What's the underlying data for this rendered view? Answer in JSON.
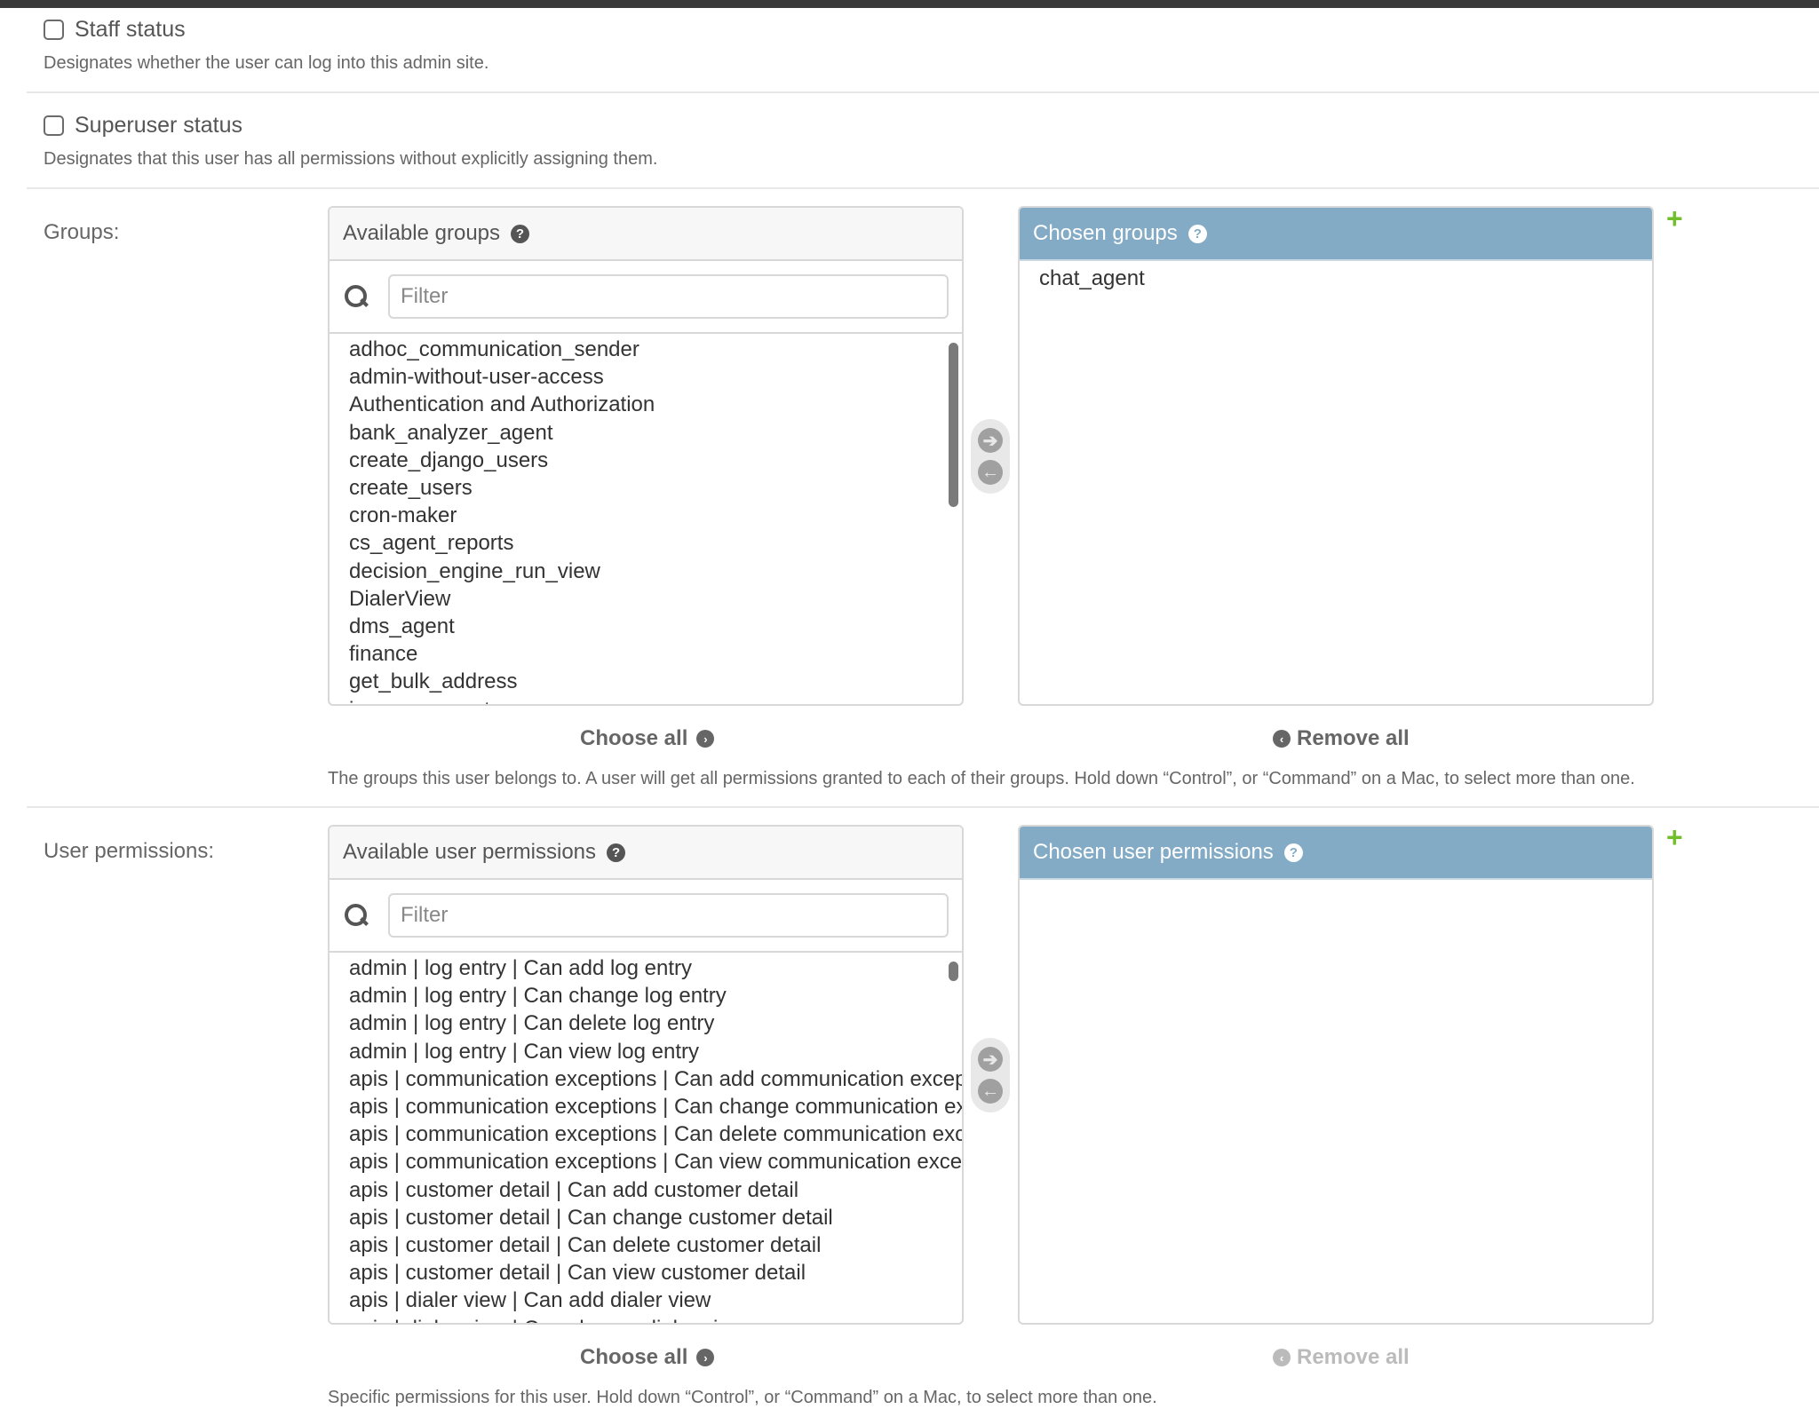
{
  "staff_status": {
    "label": "Staff status",
    "checked": false,
    "help": "Designates whether the user can log into this admin site."
  },
  "superuser_status": {
    "label": "Superuser status",
    "checked": false,
    "help": "Designates that this user has all permissions without explicitly assigning them."
  },
  "groups": {
    "label": "Groups:",
    "available_title": "Available groups",
    "chosen_title": "Chosen groups",
    "filter_placeholder": "Filter",
    "filter_value": "",
    "available": [
      "adhoc_communication_sender",
      "admin-without-user-access",
      "Authentication and Authorization",
      "bank_analyzer_agent",
      "create_django_users",
      "create_users",
      "cron-maker",
      "cs_agent_reports",
      "decision_engine_run_view",
      "DialerView",
      "dms_agent",
      "finance",
      "get_bulk_address",
      "insurance_partners"
    ],
    "chosen": [
      "chat_agent"
    ],
    "choose_all_label": "Choose all",
    "remove_all_label": "Remove all",
    "remove_all_enabled": true,
    "help": "The groups this user belongs to. A user will get all permissions granted to each of their groups. Hold down “Control”, or “Command” on a Mac, to select more than one."
  },
  "user_permissions": {
    "label": "User permissions:",
    "available_title": "Available user permissions",
    "chosen_title": "Chosen user permissions",
    "filter_placeholder": "Filter",
    "filter_value": "",
    "available": [
      "admin | log entry | Can add log entry",
      "admin | log entry | Can change log entry",
      "admin | log entry | Can delete log entry",
      "admin | log entry | Can view log entry",
      "apis | communication exceptions | Can add communication exceptions",
      "apis | communication exceptions | Can change communication exceptions",
      "apis | communication exceptions | Can delete communication exceptions",
      "apis | communication exceptions | Can view communication exceptions",
      "apis | customer detail | Can add customer detail",
      "apis | customer detail | Can change customer detail",
      "apis | customer detail | Can delete customer detail",
      "apis | customer detail | Can view customer detail",
      "apis | dialer view | Can add dialer view",
      "apis | dialer view | Can change dialer view"
    ],
    "chosen": [],
    "choose_all_label": "Choose all",
    "remove_all_label": "Remove all",
    "remove_all_enabled": false,
    "help": "Specific permissions for this user. Hold down “Control”, or “Command” on a Mac, to select more than one."
  },
  "icons": {
    "help": "?",
    "add": "+",
    "arrow_right": "➔",
    "arrow_left": "←",
    "chevron_right": "›",
    "chevron_left": "‹"
  }
}
